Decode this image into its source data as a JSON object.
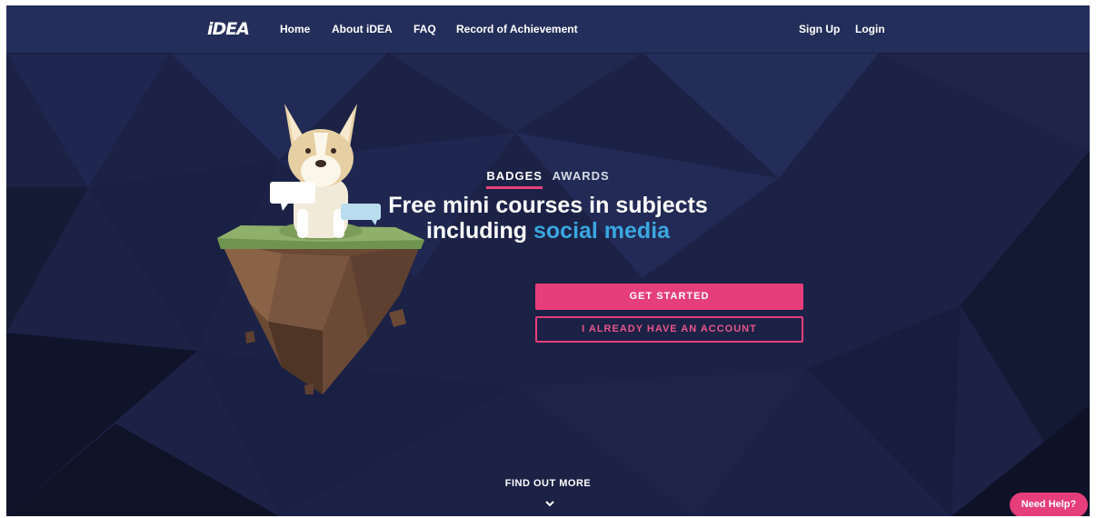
{
  "nav": {
    "logo": "iDEA",
    "links": [
      "Home",
      "About iDEA",
      "FAQ",
      "Record of Achievement"
    ],
    "auth": [
      "Sign Up",
      "Login"
    ]
  },
  "hero": {
    "tabs": [
      "BADGES",
      "AWARDS"
    ],
    "headline_line1": "Free mini courses in subjects",
    "headline_line2_prefix": "including ",
    "headline_accent": "social media",
    "get_started": "GET STARTED",
    "have_account": "I ALREADY HAVE AN ACCOUNT"
  },
  "footer": {
    "find_out_more": "FIND OUT MORE",
    "need_help": "Need Help?"
  },
  "colors": {
    "nav_bg": "#242e5a",
    "bg": "#1b2140",
    "accent_pink": "#e63e7a",
    "accent_blue": "#3aa6df"
  },
  "icons": [
    "corgi-illustration",
    "chevron-down-icon"
  ]
}
